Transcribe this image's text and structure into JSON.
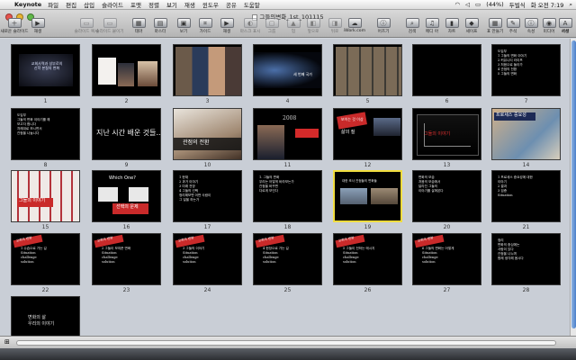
{
  "menubar": {
    "app_name": "Keynote",
    "items": [
      "파일",
      "편집",
      "삽입",
      "슬라이드",
      "포맷",
      "정렬",
      "보기",
      "재생",
      "윈도우",
      "공유",
      "도움말"
    ],
    "battery": "(44%)",
    "input_method": "두벌식",
    "clock": "화 오전 7:19"
  },
  "window": {
    "title": "그들의변화_1st_101115"
  },
  "toolbar": {
    "buttons": [
      {
        "label": "새로운 슬라이드",
        "icon": "new-slide-icon",
        "glyph": "＋"
      },
      {
        "label": "재생",
        "icon": "play-icon",
        "glyph": "▶"
      },
      {
        "label": "슬라이드 복사",
        "icon": "copy-slide-icon",
        "glyph": "▭"
      },
      {
        "label": "슬라이드 붙이기",
        "icon": "paste-slide-icon",
        "glyph": "▭"
      },
      {
        "label": "테마",
        "icon": "theme-icon",
        "glyph": "▦"
      },
      {
        "label": "마스터",
        "icon": "master-icon",
        "glyph": "▤"
      },
      {
        "label": "보기",
        "icon": "view-icon",
        "glyph": "▣"
      },
      {
        "label": "가이드",
        "icon": "guide-icon",
        "glyph": "⌗"
      },
      {
        "label": "재생",
        "icon": "play-icon-2",
        "glyph": "▶"
      },
      {
        "label": "마스크 표시",
        "icon": "mask-icon",
        "glyph": "◐"
      },
      {
        "label": "그룹",
        "icon": "group-icon",
        "glyph": "▢"
      },
      {
        "label": "업",
        "icon": "up-icon",
        "glyph": "▲"
      },
      {
        "label": "앞으로",
        "icon": "front-icon",
        "glyph": "◧"
      },
      {
        "label": "뒤로",
        "icon": "back-icon",
        "glyph": "◨"
      },
      {
        "label": "iWork.com",
        "icon": "iwork-icon",
        "glyph": "☁"
      },
      {
        "label": "어즈기",
        "icon": "inspector-icon",
        "glyph": "ⓘ"
      },
      {
        "label": "검색",
        "icon": "search-icon",
        "glyph": "⌕"
      },
      {
        "label": "메디 아",
        "icon": "media-icon",
        "glyph": "♫"
      },
      {
        "label": "차트",
        "icon": "chart-icon",
        "glyph": "▮"
      },
      {
        "label": "셰이프",
        "icon": "shape-icon",
        "glyph": "◆"
      },
      {
        "label": "표 만들기",
        "icon": "table-icon",
        "glyph": "▦"
      },
      {
        "label": "주석",
        "icon": "comment-icon",
        "glyph": "✎"
      },
      {
        "label": "속성",
        "icon": "properties-icon",
        "glyph": "ⓘ"
      },
      {
        "label": "미디어",
        "icon": "media-browser-icon",
        "glyph": "◉"
      },
      {
        "label": "색상",
        "icon": "colors-icon",
        "glyph": "●"
      },
      {
        "label": "서체",
        "icon": "fonts-icon",
        "glyph": "A"
      }
    ]
  },
  "slides": [
    {
      "n": "1",
      "kind": "title",
      "text": "교회사역과 성부로의\n신학 본질의 변화"
    },
    {
      "n": "2",
      "kind": "people"
    },
    {
      "n": "3",
      "kind": "collage"
    },
    {
      "n": "4",
      "kind": "film",
      "text": "세 번째 국가"
    },
    {
      "n": "5",
      "kind": "grid"
    },
    {
      "n": "6",
      "kind": "blank"
    },
    {
      "n": "7",
      "kind": "hand",
      "text": "도입부\n1 그들의 변화 이야기\n2 커뮤니티 라이프\n3 처음으로 돌아가\n4 관점의 전환\n5 그들의 변화"
    },
    {
      "n": "8",
      "kind": "hand",
      "text": "도입부\n그들의 변화 이야기를 해\n보고자 합니다\n차례대로 보시면서\n관점을 나눕니다"
    },
    {
      "n": "9",
      "kind": "bigtext",
      "text": "지난 시간 배운 것들..."
    },
    {
      "n": "10",
      "kind": "arch",
      "text": "관점의 전환"
    },
    {
      "n": "11",
      "kind": "obama",
      "text": "2008"
    },
    {
      "n": "12",
      "kind": "red",
      "tag": "보이는 것 이상",
      "text": "삶의 질"
    },
    {
      "n": "13",
      "kind": "graph",
      "text": "그들의 이야기"
    },
    {
      "n": "14",
      "kind": "workers",
      "text": "프로세스 중요성"
    },
    {
      "n": "15",
      "kind": "dolls",
      "text": "그들의 이야기"
    },
    {
      "n": "16",
      "kind": "which",
      "text": "Which One?",
      "sub": "선택의 문제"
    },
    {
      "n": "17",
      "kind": "hand",
      "text": "1 현재\n2 과거 이야기\n3 미래 전망\n4 그들의 선택\n정리해보면 어떤 사람이\n그 일을 하는가"
    },
    {
      "n": "18",
      "kind": "hand",
      "text": "1. 그들의 변화\n우리는 어떻게 바라보는가\n관점을 바꾸면\n다르게 보인다"
    },
    {
      "n": "19",
      "kind": "photos",
      "text": "대한 조사 관점들의 변화들"
    },
    {
      "n": "20",
      "kind": "hand",
      "text": "변화의 모습\n처음의 모습에서\n달라진 그들의\n이야기를 살펴본다"
    },
    {
      "n": "21",
      "kind": "hand",
      "text": "1 프로세스 중요성에 대한\n이야기\n2 결과\n3 검증\nSituation"
    },
    {
      "n": "22",
      "kind": "tag",
      "tag": "교회의 변화",
      "text": "1 수습으로 가는 길\nSituation\nchallenge\nsolution"
    },
    {
      "n": "23",
      "kind": "tag",
      "tag": "교회의 변화",
      "text": "2 그들이 보여준 변화\nSituation\nchallenge\nsolution"
    },
    {
      "n": "24",
      "kind": "tag",
      "tag": "교회의 변화",
      "text": "3 그들의 이야기\nSituation\nchallenge\nsolution"
    },
    {
      "n": "25",
      "kind": "tag",
      "tag": "교회의 변화",
      "text": "4 현장으로 가는 길\nSituation\nchallenge\nsolution"
    },
    {
      "n": "26",
      "kind": "tag",
      "tag": "교회의 변화",
      "text": "5 그들이 전하는 메시지\nSituation\nchallenge\nsolution"
    },
    {
      "n": "27",
      "kind": "tag",
      "tag": "교회의 변화",
      "text": "6 그들의 변화는 어떻게\nSituation\nchallenge\nsolution"
    },
    {
      "n": "28",
      "kind": "hand",
      "text": "정리\n변화의 중심에는\n사람이 있다\n관점을 나누며\n함께 생각해 봅시다"
    },
    {
      "n": "29",
      "kind": "closing",
      "text": "변화의 삶\n우리의 이야기"
    }
  ],
  "colors": {
    "tag_red": "#d42a2a",
    "selection": "#f1dd3e"
  }
}
